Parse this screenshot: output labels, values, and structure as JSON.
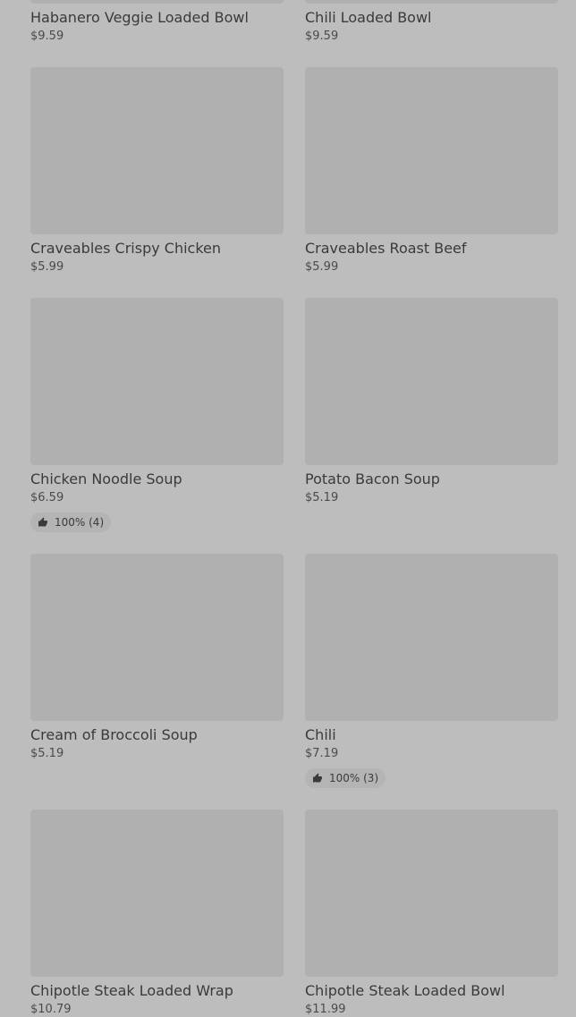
{
  "items": [
    {
      "name": "Habanero Veggie Loaded Bowl",
      "price": "$9.59"
    },
    {
      "name": "Chili Loaded Bowl",
      "price": "$9.59"
    },
    {
      "name": "Craveables Crispy Chicken",
      "price": "$5.99"
    },
    {
      "name": "Craveables Roast Beef",
      "price": "$5.99"
    },
    {
      "name": "Chicken Noodle Soup",
      "price": "$6.59",
      "rating": "100% (4)"
    },
    {
      "name": "Potato Bacon Soup",
      "price": "$5.19"
    },
    {
      "name": "Cream of Broccoli Soup",
      "price": "$5.19"
    },
    {
      "name": "Chili",
      "price": "$7.19",
      "rating": "100% (3)"
    },
    {
      "name": "Chipotle Steak Loaded Wrap",
      "price": "$10.79"
    },
    {
      "name": "Chipotle Steak Loaded Bowl",
      "price": "$11.99"
    }
  ]
}
